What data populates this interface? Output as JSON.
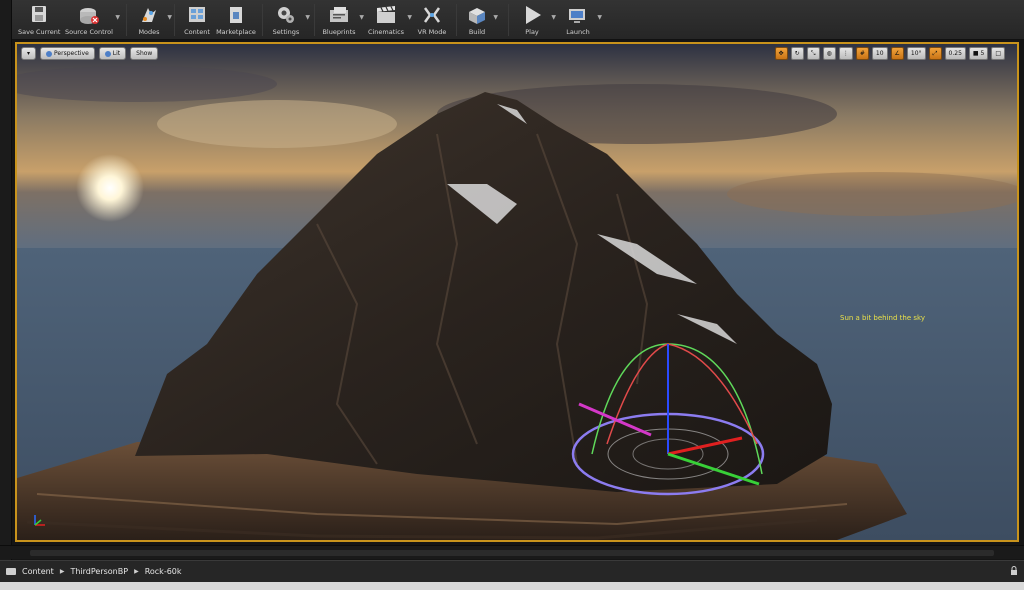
{
  "toolbar": {
    "buttons": [
      {
        "label": "Save Current",
        "icon": "save-icon"
      },
      {
        "label": "Source Control",
        "icon": "source-control-icon"
      },
      {
        "label": "Modes",
        "icon": "modes-icon"
      },
      {
        "label": "Content",
        "icon": "content-icon"
      },
      {
        "label": "Marketplace",
        "icon": "marketplace-icon"
      },
      {
        "label": "Settings",
        "icon": "settings-icon"
      },
      {
        "label": "Blueprints",
        "icon": "blueprints-icon"
      },
      {
        "label": "Cinematics",
        "icon": "cinematics-icon"
      },
      {
        "label": "VR Mode",
        "icon": "vr-mode-icon"
      },
      {
        "label": "Build",
        "icon": "build-icon"
      },
      {
        "label": "Play",
        "icon": "play-icon"
      },
      {
        "label": "Launch",
        "icon": "launch-icon"
      }
    ]
  },
  "viewport": {
    "perspective_label": "Perspective",
    "lit_label": "Lit",
    "show_label": "Show",
    "grid_snap": "10",
    "rotation_snap": "10°",
    "scale_snap": "0.25",
    "camera_speed": "5",
    "message": "Sun a bit behind the sky",
    "accent_color": "#c8931c",
    "message_color": "#e8e04a"
  },
  "content_browser": {
    "breadcrumb": [
      "Content",
      "ThirdPersonBP",
      "Rock-60k"
    ]
  }
}
